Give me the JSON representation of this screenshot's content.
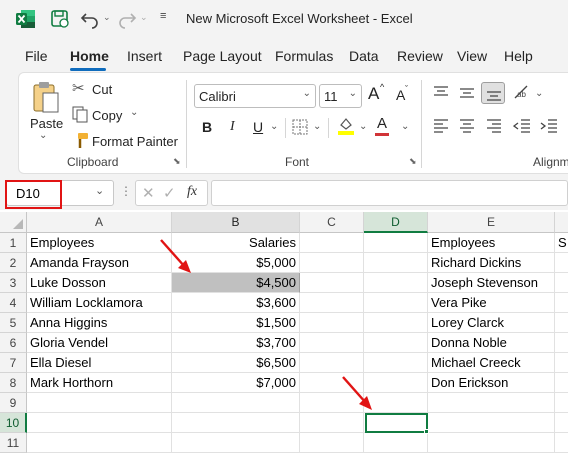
{
  "titlebar": {
    "app_icon": "excel-logo-icon",
    "title": "New Microsoft Excel Worksheet  -  Excel"
  },
  "menu": {
    "tabs": [
      "File",
      "Home",
      "Insert",
      "Page Layout",
      "Formulas",
      "Data",
      "Review",
      "View",
      "Help"
    ],
    "active": "Home"
  },
  "ribbon": {
    "clipboard": {
      "paste": "Paste",
      "cut": "Cut",
      "copy": "Copy",
      "format_painter": "Format Painter",
      "group_label": "Clipboard"
    },
    "font": {
      "font_name": "Calibri",
      "font_size": "11",
      "bold": "B",
      "italic": "I",
      "underline": "U",
      "grow": "A",
      "shrink": "A",
      "font_color_letter": "A",
      "font_color": "#d13438",
      "highlight_color": "#ffff00",
      "group_label": "Font"
    },
    "alignment": {
      "group_label": "Alignm"
    }
  },
  "formula_bar": {
    "name_box": "D10",
    "fx": "fx",
    "formula": ""
  },
  "grid": {
    "columns": [
      "A",
      "B",
      "C",
      "D",
      "E"
    ],
    "partial_column_text": "S",
    "rows": [
      {
        "n": "1",
        "A": "Employees",
        "B": "Salaries",
        "E": "Employees"
      },
      {
        "n": "2",
        "A": "Amanda Frayson",
        "B": "$5,000",
        "E": "Richard Dickins"
      },
      {
        "n": "3",
        "A": "Luke Dosson",
        "B": "$4,500",
        "E": "Joseph Stevenson"
      },
      {
        "n": "4",
        "A": "William Locklamora",
        "B": "$3,600",
        "E": "Vera Pike"
      },
      {
        "n": "5",
        "A": "Anna Higgins",
        "B": "$1,500",
        "E": "Lorey Clarck"
      },
      {
        "n": "6",
        "A": "Gloria Vendel",
        "B": "$3,700",
        "E": "Donna Noble"
      },
      {
        "n": "7",
        "A": "Ella Diesel",
        "B": "$6,500",
        "E": "Michael Creeck"
      },
      {
        "n": "8",
        "A": "Mark Horthorn",
        "B": "$7,000",
        "E": "Don Erickson"
      },
      {
        "n": "9"
      },
      {
        "n": "10"
      },
      {
        "n": "11"
      }
    ],
    "selected_cell": "D10",
    "highlighted_cell": "B3",
    "highlight_fill": "#c0c0c0",
    "selection_color": "#107c41",
    "annotation_color": "#e11414"
  }
}
